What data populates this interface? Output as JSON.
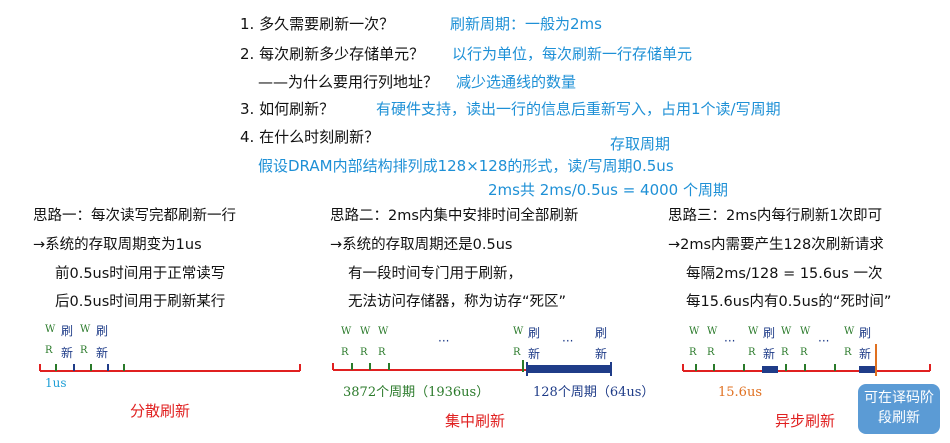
{
  "questions": {
    "q1": "1. 多久需要刷新一次？",
    "a1": "刷新周期：一般为2ms",
    "q2": "2. 每次刷新多少存储单元？",
    "a2": "以行为单位，每次刷新一行存储单元",
    "q2b": "——为什么要用行列地址？",
    "a2b": "减少选通线的数量",
    "q3": "3. 如何刷新？",
    "a3": "有硬件支持，读出一行的信息后重新写入，占用1个读/写周期",
    "q4": "4. 在什么时刻刷新？",
    "a4_access": "存取周期",
    "a4_line": "假设DRAM内部结构排列成128×128的形式，读/写周期0.5us",
    "a4_total": "2ms共 2ms/0.5us = 4000 个周期"
  },
  "ideas": [
    {
      "title": "思路一：每次读写完都刷新一行",
      "l1": "→系统的存取周期变为1us",
      "l2": "前0.5us时间用于正常读写",
      "l3": "后0.5us时间用于刷新某行",
      "label": "分散刷新"
    },
    {
      "title": "思路二：2ms内集中安排时间全部刷新",
      "l1": "→系统的存取周期还是0.5us",
      "l2": "有一段时间专门用于刷新，",
      "l3": "无法访问存储器，称为访存“死区”",
      "label": "集中刷新"
    },
    {
      "title": "思路三：2ms内每行刷新1次即可",
      "l1": "→2ms内需要产生128次刷新请求",
      "l2": "每隔2ms/128 = 15.6us 一次",
      "l3": "每15.6us内有0.5us的“死时间”",
      "label": "异步刷新"
    }
  ],
  "diagram": {
    "w": "W",
    "r": "R",
    "shua": "刷",
    "xin": "新",
    "dots": "···",
    "d1_note": "1us",
    "d2_note_left": "3872个周期（1936us）",
    "d2_note_right": "128个周期（64us）",
    "d3_note": "15.6us",
    "bubble": "可在译码阶段刷新"
  },
  "colors": {
    "answer": "#1e90d6",
    "axis": "#e02020",
    "green": "#2a7a2a",
    "navy": "#1f3c88",
    "bubble": "#5b9bd5"
  }
}
